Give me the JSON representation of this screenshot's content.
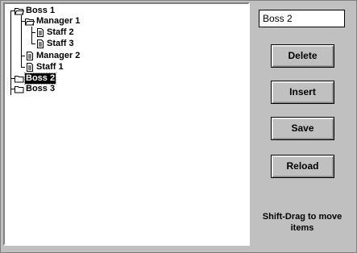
{
  "tree": {
    "items": [
      {
        "label": "Boss 1",
        "icon": "folder-open-icon",
        "level": 0
      },
      {
        "label": "Manager 1",
        "icon": "folder-open-icon",
        "level": 1
      },
      {
        "label": "Staff 2",
        "icon": "document-icon",
        "level": 2
      },
      {
        "label": "Staff 3",
        "icon": "document-icon",
        "level": 2
      },
      {
        "label": "Manager 2",
        "icon": "document-icon",
        "level": 1
      },
      {
        "label": "Staff 1",
        "icon": "document-icon",
        "level": 1
      },
      {
        "label": "Boss 2",
        "icon": "folder-closed-icon",
        "level": 0,
        "selected": true
      },
      {
        "label": "Boss 3",
        "icon": "folder-closed-icon",
        "level": 0
      }
    ]
  },
  "edit": {
    "value": "Boss 2"
  },
  "buttons": {
    "delete": "Delete",
    "insert": "Insert",
    "save": "Save",
    "reload": "Reload"
  },
  "hint": {
    "line1": "Shift-Drag to move",
    "line2": "items"
  }
}
